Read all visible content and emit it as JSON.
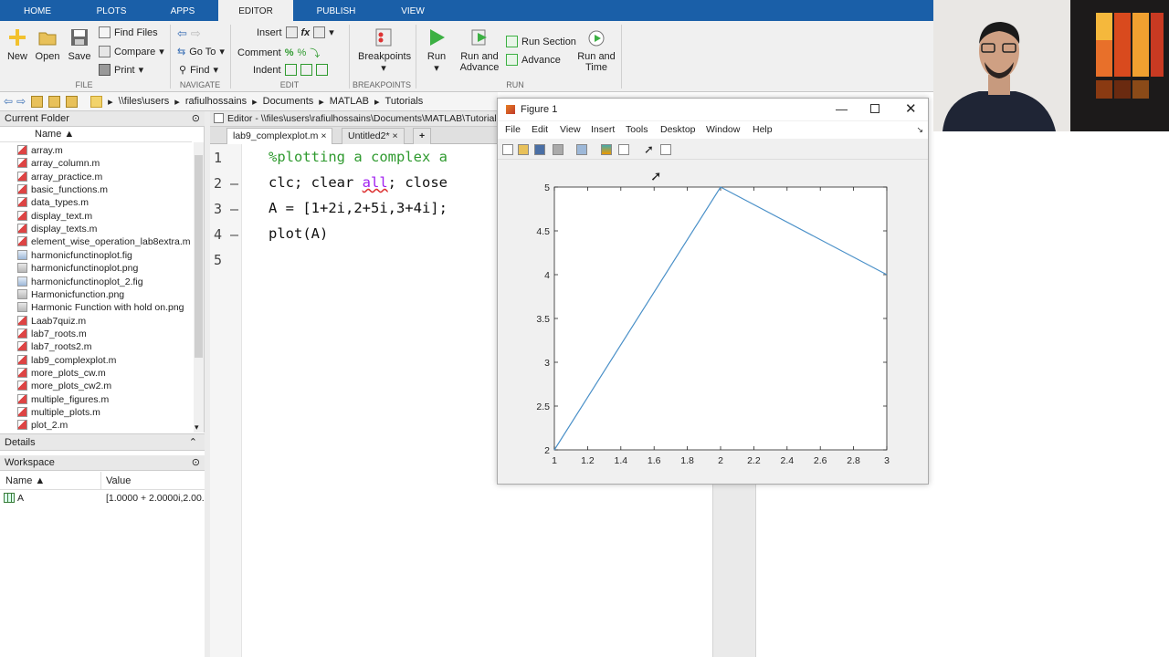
{
  "tabs": [
    "HOME",
    "PLOTS",
    "APPS",
    "EDITOR",
    "PUBLISH",
    "VIEW"
  ],
  "ribbon": {
    "new_label": "New",
    "open_label": "Open",
    "save_label": "Save",
    "find_files": "Find Files",
    "compare": "Compare",
    "print": "Print",
    "go_to": "Go To",
    "find": "Find",
    "insert": "Insert",
    "comment": "Comment",
    "indent": "Indent",
    "breakpoints": "Breakpoints",
    "run": "Run",
    "run_and_advance_1": "Run and",
    "run_and_advance_2": "Advance",
    "run_section": "Run Section",
    "advance": "Advance",
    "run_and_time_1": "Run and",
    "run_and_time_2": "Time",
    "groups": {
      "file": "FILE",
      "navigate": "NAVIGATE",
      "edit": "EDIT",
      "breakpoints": "BREAKPOINTS",
      "run": "RUN"
    }
  },
  "address": {
    "path": [
      "\\\\files\\users",
      "rafiulhossains",
      "Documents",
      "MATLAB",
      "Tutorials"
    ]
  },
  "current_folder": {
    "title": "Current Folder",
    "column": "Name ▲",
    "files": [
      {
        "name": "array.m",
        "type": "m"
      },
      {
        "name": "array_column.m",
        "type": "m"
      },
      {
        "name": "array_practice.m",
        "type": "m"
      },
      {
        "name": "basic_functions.m",
        "type": "m"
      },
      {
        "name": "data_types.m",
        "type": "m"
      },
      {
        "name": "display_text.m",
        "type": "m"
      },
      {
        "name": "display_texts.m",
        "type": "m"
      },
      {
        "name": "element_wise_operation_lab8extra.m",
        "type": "m"
      },
      {
        "name": "harmonicfunctinoplot.fig",
        "type": "fig"
      },
      {
        "name": "harmonicfunctinoplot.png",
        "type": "png"
      },
      {
        "name": "harmonicfunctinoplot_2.fig",
        "type": "fig"
      },
      {
        "name": "Harmonicfunction.png",
        "type": "png"
      },
      {
        "name": "Harmonic Function with hold on.png",
        "type": "png"
      },
      {
        "name": "Laab7quiz.m",
        "type": "m"
      },
      {
        "name": "lab7_roots.m",
        "type": "m"
      },
      {
        "name": "lab7_roots2.m",
        "type": "m"
      },
      {
        "name": "lab9_complexplot.m",
        "type": "m"
      },
      {
        "name": "more_plots_cw.m",
        "type": "m"
      },
      {
        "name": "more_plots_cw2.m",
        "type": "m"
      },
      {
        "name": "multiple_figures.m",
        "type": "m"
      },
      {
        "name": "multiple_plots.m",
        "type": "m"
      },
      {
        "name": "plot_2.m",
        "type": "m"
      }
    ]
  },
  "details": {
    "title": "Details"
  },
  "workspace": {
    "title": "Workspace",
    "col_name": "Name ▲",
    "col_value": "Value",
    "var_name": "A",
    "var_value": "[1.0000 + 2.0000i,2.00..."
  },
  "editor": {
    "title": "Editor - \\\\files\\users\\rafiulhossains\\Documents\\MATLAB\\Tutorials",
    "tab1": "lab9_complexplot.m",
    "tab2": "Untitled2*",
    "tab_add": "+",
    "line_nums": [
      "1",
      "2 —",
      "3 —",
      "4 —",
      "5"
    ],
    "line1": "%plotting a complex a",
    "line2a": "clc; clear ",
    "line2b": "all",
    "line2c": "; close",
    "line3": "A = [1+2i,2+5i,3+4i];",
    "line4": "plot(A)"
  },
  "figure": {
    "title": "Figure 1",
    "menu": [
      "File",
      "Edit",
      "View",
      "Insert",
      "Tools",
      "Desktop",
      "Window",
      "Help"
    ]
  },
  "chart_data": {
    "type": "line",
    "x": [
      1,
      2,
      3
    ],
    "y": [
      2,
      5,
      4
    ],
    "xlim": [
      1,
      3
    ],
    "ylim": [
      2,
      5
    ],
    "xticks": [
      "1",
      "1.2",
      "1.4",
      "1.6",
      "1.8",
      "2",
      "2.2",
      "2.4",
      "2.6",
      "2.8",
      "3"
    ],
    "yticks": [
      "2",
      "2.5",
      "3",
      "3.5",
      "4",
      "4.5",
      "5"
    ],
    "line_color": "#4a90c8"
  },
  "colors": {
    "tabbar": "#1a5fa8",
    "comment": "#2f9a2f",
    "string": "#a020f0"
  }
}
